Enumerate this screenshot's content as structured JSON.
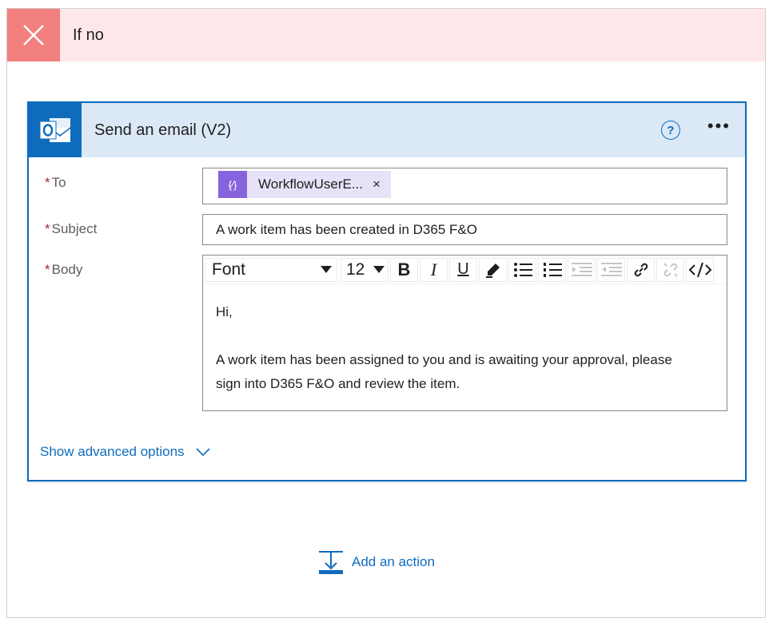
{
  "condition": {
    "title": "If no",
    "icon": "close-icon",
    "icon_bg": "#f1807e",
    "header_bg": "#fde7e9"
  },
  "action_card": {
    "title": "Send an email (V2)",
    "app_icon": "outlook-icon",
    "help_icon": "?",
    "more_icon": "•••",
    "accent": "#0f6cbd",
    "fields": {
      "to": {
        "required_mark": "*",
        "label": "To",
        "token_text": "WorkflowUserE...",
        "token_icon": "{⁄}",
        "token_remove": "×"
      },
      "subject": {
        "required_mark": "*",
        "label": "Subject",
        "value": "A work item has been created in D365 F&O"
      },
      "body": {
        "required_mark": "*",
        "label": "Body",
        "toolbar": {
          "font": "Font",
          "size": "12",
          "buttons": [
            "bold",
            "italic",
            "underline",
            "highlight",
            "bulleted-list",
            "numbered-list",
            "increase-indent",
            "decrease-indent",
            "link",
            "unlink",
            "code-view"
          ]
        },
        "lines": [
          "Hi,",
          "A work item has been assigned to you and is awaiting your approval, please",
          "sign into D365 F&O and review the item."
        ]
      }
    },
    "advanced_options": "Show advanced options"
  },
  "add_action": {
    "label": "Add an action"
  }
}
